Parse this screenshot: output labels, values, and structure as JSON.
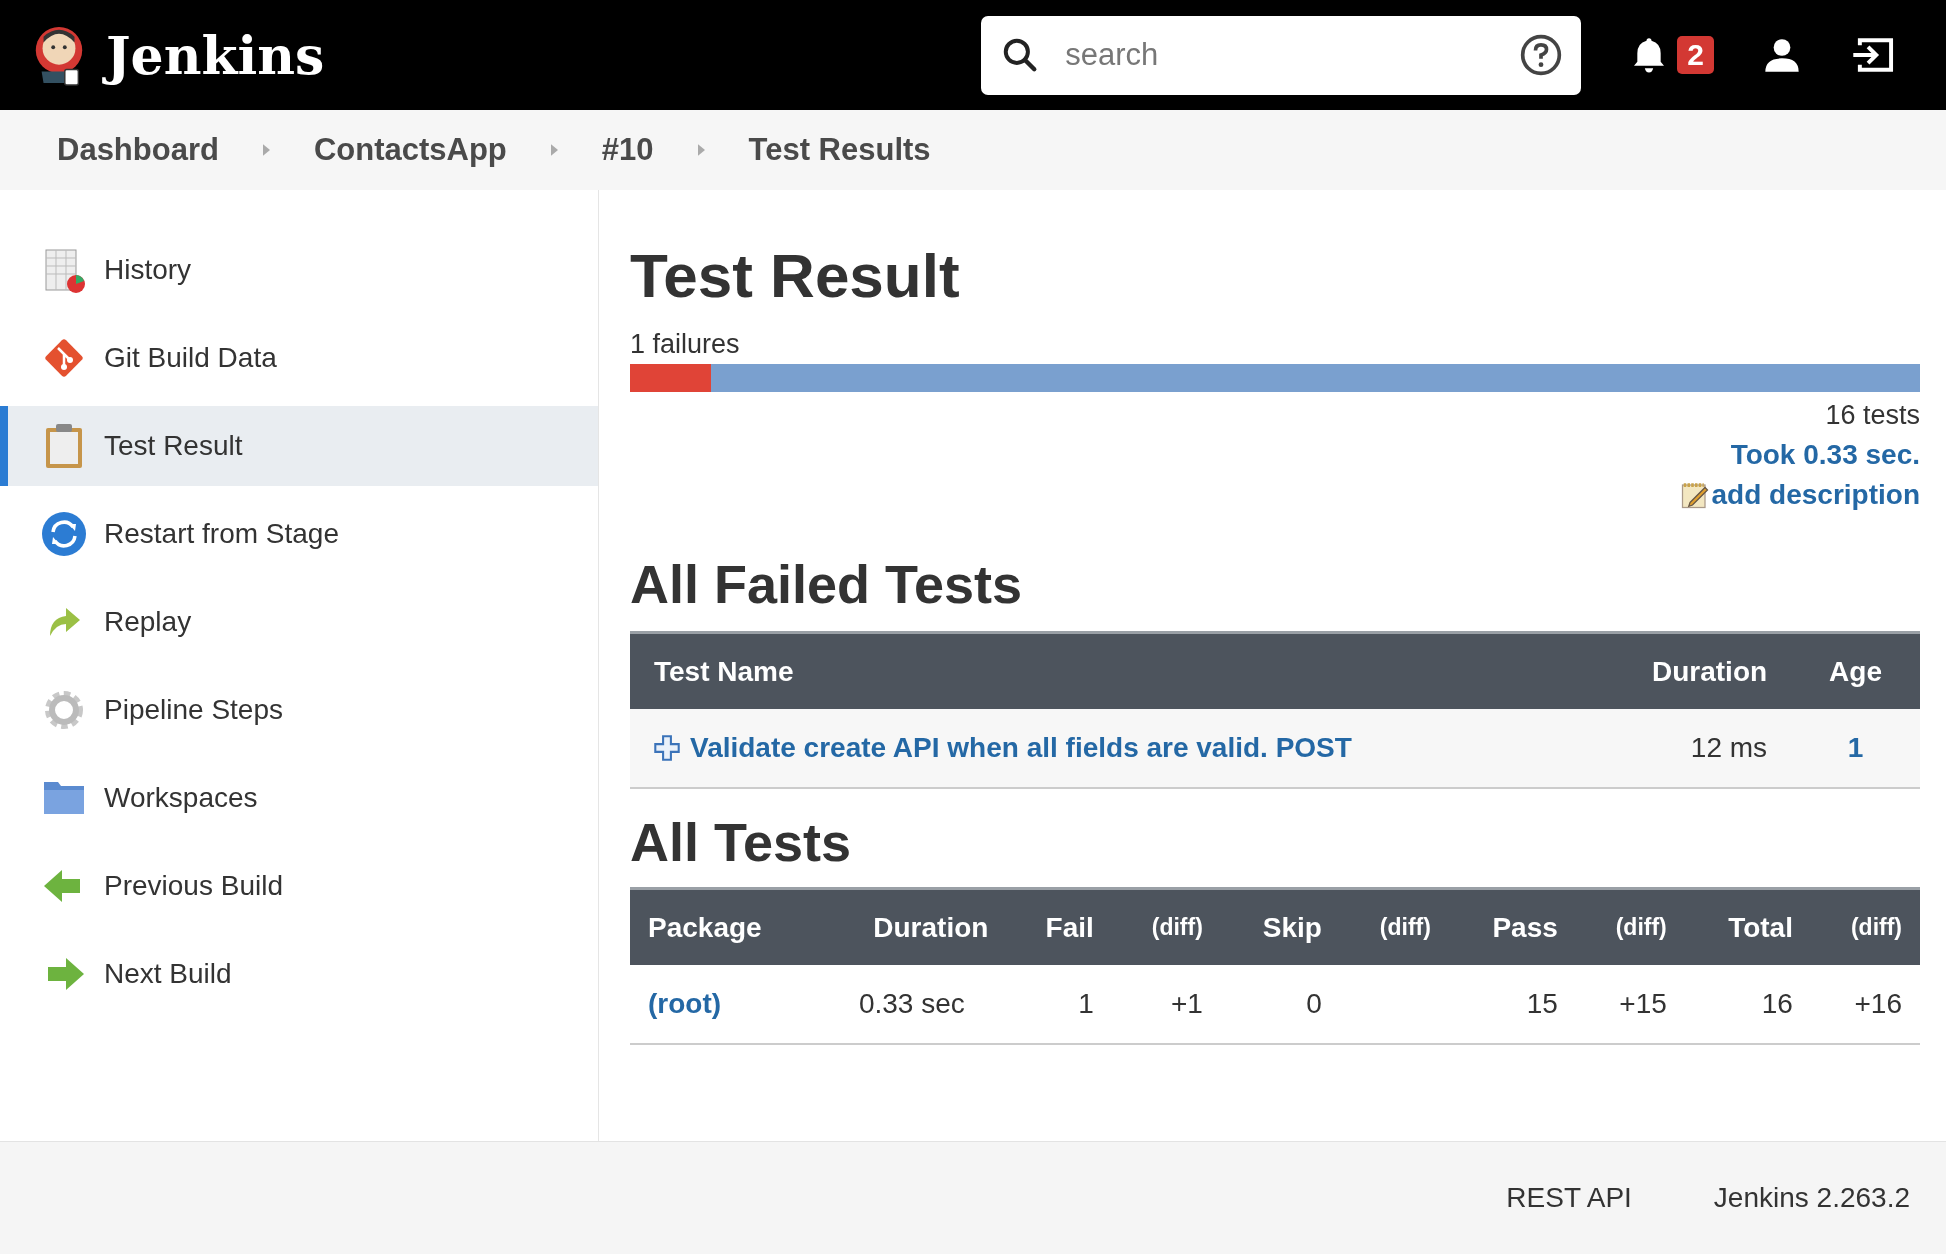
{
  "header": {
    "brand": "Jenkins",
    "search": {
      "placeholder": "search"
    },
    "notification_count": "2"
  },
  "breadcrumbs": [
    "Dashboard",
    "ContactsApp",
    "#10",
    "Test Results"
  ],
  "sidebar": {
    "items": [
      {
        "label": "History",
        "kind": "history",
        "selected": false
      },
      {
        "label": "Git Build Data",
        "kind": "git",
        "selected": false
      },
      {
        "label": "Test Result",
        "kind": "clipboard",
        "selected": true
      },
      {
        "label": "Restart from Stage",
        "kind": "restart",
        "selected": false
      },
      {
        "label": "Replay",
        "kind": "replay",
        "selected": false
      },
      {
        "label": "Pipeline Steps",
        "kind": "gear",
        "selected": false
      },
      {
        "label": "Workspaces",
        "kind": "folder",
        "selected": false
      },
      {
        "label": "Previous Build",
        "kind": "previous",
        "selected": false
      },
      {
        "label": "Next Build",
        "kind": "next",
        "selected": false
      }
    ]
  },
  "main": {
    "title": "Test Result",
    "failures_label": "1 failures",
    "failure_bar": {
      "level": 0.0625
    },
    "tests_count": "16 tests",
    "took": "Took 0.33 sec.",
    "add_description": "add description",
    "failed_section": {
      "heading": "All Failed Tests",
      "columns": [
        "Test Name",
        "Duration",
        "Age"
      ],
      "rows": [
        {
          "test_name": "Validate create API when all fields are valid. POST",
          "duration": "12 ms",
          "age": "1"
        }
      ]
    },
    "all_section": {
      "heading": "All Tests",
      "columns": [
        "Package",
        "Duration",
        "Fail",
        "(diff)",
        "Skip",
        "(diff)",
        "Pass",
        "(diff)",
        "Total",
        "(diff)"
      ],
      "rows": [
        {
          "cells": [
            "(root)",
            "0.33 sec",
            "1",
            "+1",
            "0",
            null,
            "15",
            "+15",
            "16",
            "+16"
          ]
        }
      ]
    }
  },
  "footer": {
    "links": [
      "REST API",
      "Jenkins 2.263.2"
    ]
  }
}
